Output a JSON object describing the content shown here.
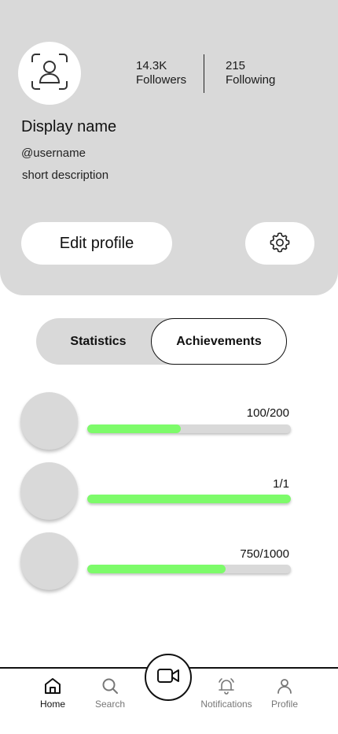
{
  "profile": {
    "display_name": "Display name",
    "username": "@username",
    "description": "short description",
    "followers_count": "14.3K",
    "followers_label": "Followers",
    "following_count": "215",
    "following_label": "Following",
    "avatar_icon": "user-placeholder-icon",
    "edit_label": "Edit profile",
    "settings_icon": "gear-icon"
  },
  "tabs": [
    {
      "label": "Statistics",
      "selected": false
    },
    {
      "label": "Achievements",
      "selected": true
    }
  ],
  "achievements": [
    {
      "value_text": "100/200",
      "progress": 0.46
    },
    {
      "value_text": "1/1",
      "progress": 1.0
    },
    {
      "value_text": "750/1000",
      "progress": 0.68
    }
  ],
  "nav": {
    "items": [
      {
        "label": "Home",
        "icon": "home-icon",
        "active": true
      },
      {
        "label": "Search",
        "icon": "search-icon",
        "active": false
      },
      {
        "label": "Notifications",
        "icon": "bell-icon",
        "active": false
      },
      {
        "label": "Profile",
        "icon": "person-icon",
        "active": false
      }
    ],
    "record_icon": "video-camera-icon"
  },
  "colors": {
    "card_bg": "#d9d9d9",
    "progress_fill": "#7dfb6a",
    "inactive_label": "#777777"
  }
}
